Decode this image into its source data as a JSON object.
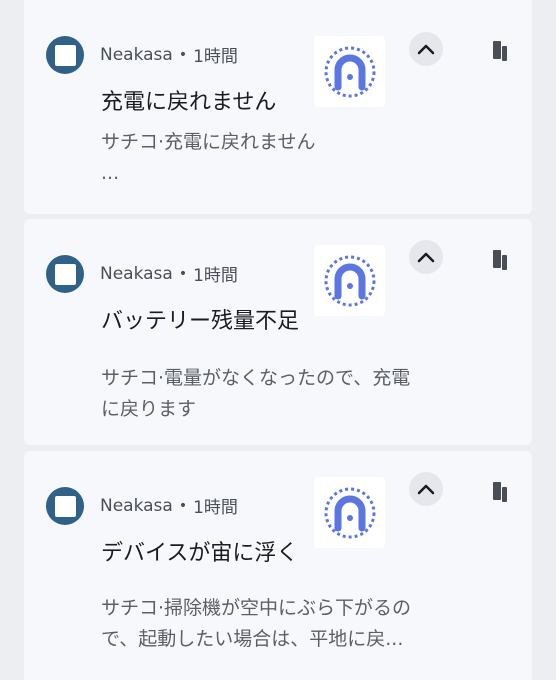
{
  "notifications": [
    {
      "app_name": "Neakasa",
      "separator": "•",
      "time": "1時間",
      "title": "充電に戻れません",
      "body_line1": "サチコ·充電に戻れません",
      "body_line2": "...",
      "app_icon": "app-square-icon",
      "thumbnail_icon": "neakasa-robot-logo",
      "expand_icon": "chevron-up-icon",
      "device_icon": "phone-device-icon"
    },
    {
      "app_name": "Neakasa",
      "separator": "•",
      "time": "1時間",
      "title": "バッテリー残量不足",
      "body_line1": "サチコ·電量がなくなったので、充電",
      "body_line2": "に戻ります",
      "app_icon": "app-square-icon",
      "thumbnail_icon": "neakasa-robot-logo",
      "expand_icon": "chevron-up-icon",
      "device_icon": "phone-device-icon"
    },
    {
      "app_name": "Neakasa",
      "separator": "•",
      "time": "1時間",
      "title": "デバイスが宙に浮く",
      "body_line1": "サチコ·掃除機が空中にぶら下がるの",
      "body_line2": "で、起動したい場合は、平地に戻...",
      "app_icon": "app-square-icon",
      "thumbnail_icon": "neakasa-robot-logo",
      "expand_icon": "chevron-up-icon",
      "device_icon": "phone-device-icon"
    }
  ],
  "colors": {
    "background": "#eceef2",
    "card": "#f7f8fb",
    "app_icon": "#2f6189",
    "logo_blue": "#5b76e0",
    "text_primary": "#1b1c1f",
    "text_secondary": "#5b5f66"
  }
}
